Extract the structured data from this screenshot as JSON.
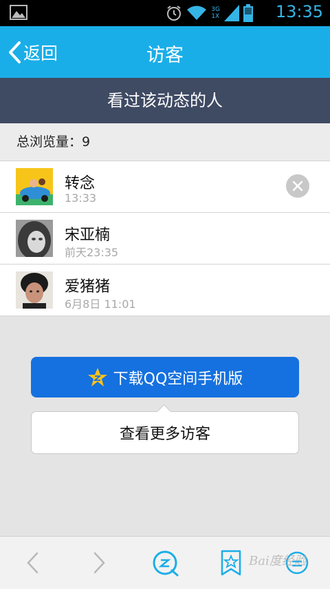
{
  "status_bar": {
    "time": "13:35",
    "icons": [
      "gallery-icon",
      "alarm-icon",
      "wifi-icon",
      "signal-icon",
      "battery-icon"
    ],
    "network_top": "3G",
    "network_bottom": "1X",
    "accent_color": "#35b5e5"
  },
  "header": {
    "back_label": "返回",
    "title": "访客",
    "background": "#1aaee8"
  },
  "section": {
    "title": "看过该动态的人",
    "background": "#3f4a63"
  },
  "summary": {
    "label": "总浏览量：9"
  },
  "visitors": [
    {
      "name": "转念",
      "time": "13:33"
    },
    {
      "name": "宋亚楠",
      "time": "前天23:35"
    },
    {
      "name": "爱猪猪",
      "time": "6月8日 11:01"
    }
  ],
  "actions": {
    "download_label": "下载QQ空间手机版",
    "download_color": "#1571df",
    "more_label": "查看更多访客"
  },
  "bottom_nav": {
    "icons": [
      "back-arrow-icon",
      "forward-arrow-icon",
      "qzone-icon",
      "bookmark-star-icon",
      "menu-icon"
    ]
  },
  "watermark": "Bai度经验"
}
